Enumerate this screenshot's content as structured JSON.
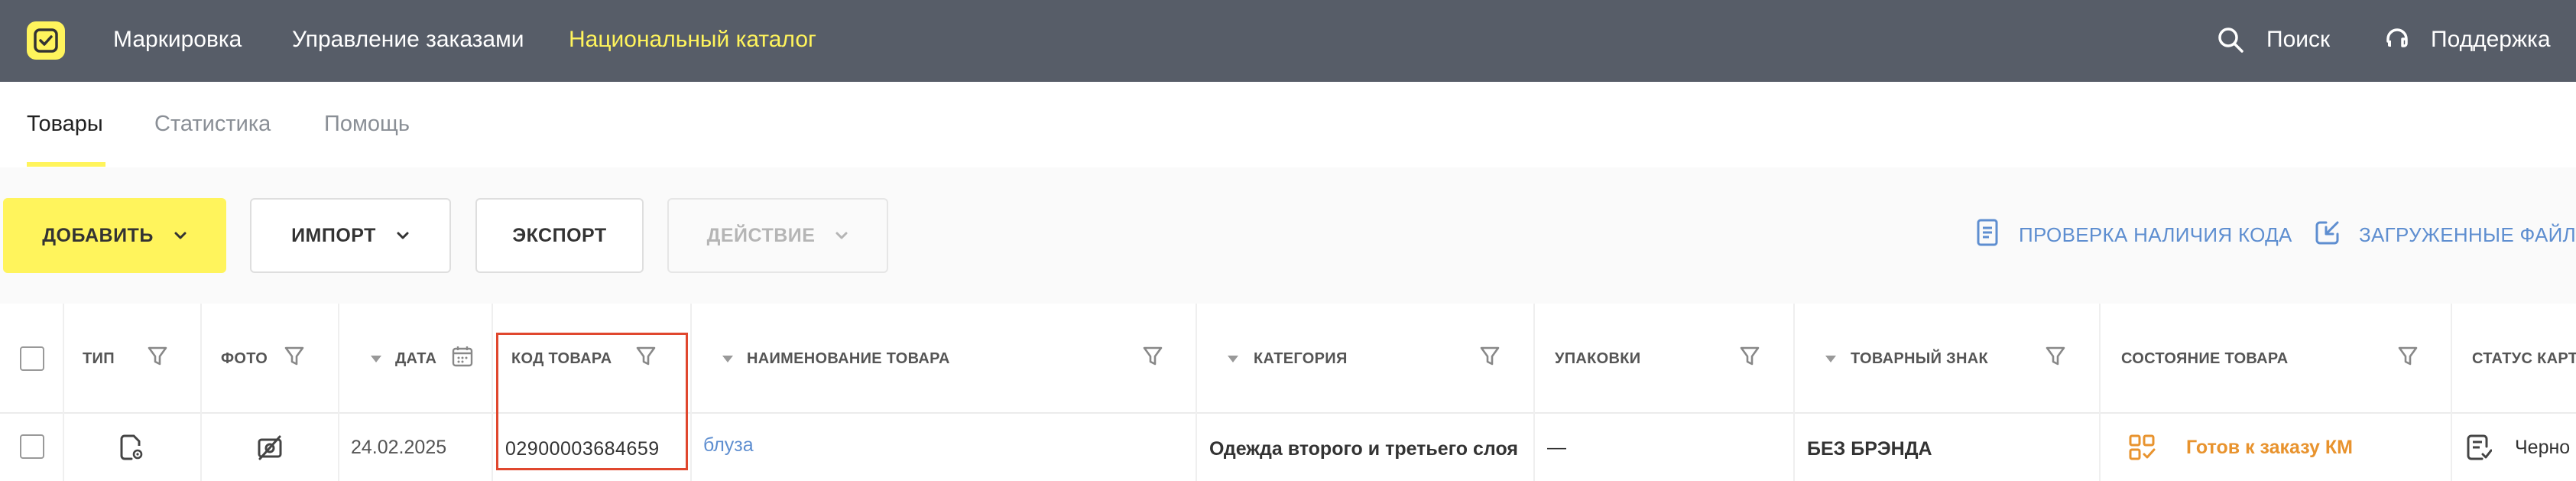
{
  "topbar": {
    "nav": [
      "Маркировка",
      "Управление заказами",
      "Национальный каталог"
    ],
    "active_nav": "Национальный каталог",
    "search_label": "Поиск",
    "support_label": "Поддержка",
    "accent_color": "#fff45c",
    "bar_color": "#575d68"
  },
  "subtabs": {
    "items": [
      "Товары",
      "Статистика",
      "Помощь"
    ],
    "active": "Товары"
  },
  "toolbar": {
    "add_label": "ДОБАВИТЬ",
    "import_label": "ИМПОРТ",
    "export_label": "ЭКСПОРТ",
    "action_label": "ДЕЙСТВИЕ",
    "check_code_label": "ПРОВЕРКА НАЛИЧИЯ КОДА",
    "uploaded_files_label": "ЗАГРУЖЕННЫЕ ФАЙЛЫ"
  },
  "table": {
    "columns": {
      "type": "ТИП",
      "photo": "ФОТО",
      "date": "ДАТА",
      "code": "КОД ТОВАРА",
      "name": "НАИМЕНОВАНИЕ ТОВАРА",
      "category": "КАТЕГОРИЯ",
      "packaging": "УПАКОВКИ",
      "trademark": "ТОВАРНЫЙ ЗНАК",
      "state": "СОСТОЯНИЕ ТОВАРА",
      "card_status": "СТАТУС КАРТ"
    },
    "rows": [
      {
        "date": "24.02.2025",
        "code": "02900003684659",
        "name": "блуза",
        "category": "Одежда второго и третьего слоя",
        "packaging": "—",
        "trademark": "БЕЗ БРЭНДА",
        "state": "Готов к заказу КМ",
        "card_status": "Черно"
      }
    ],
    "state_color": "#e8932e",
    "link_color": "#5e8ed0",
    "highlight_color": "#e0472e"
  },
  "icons": [
    "logo-icon",
    "search-icon",
    "headset-icon",
    "chevron-down-icon",
    "document-icon",
    "upload-icon",
    "filter-icon",
    "calendar-icon",
    "product-type-icon",
    "no-photo-icon",
    "qr-check-icon",
    "card-status-icon"
  ]
}
